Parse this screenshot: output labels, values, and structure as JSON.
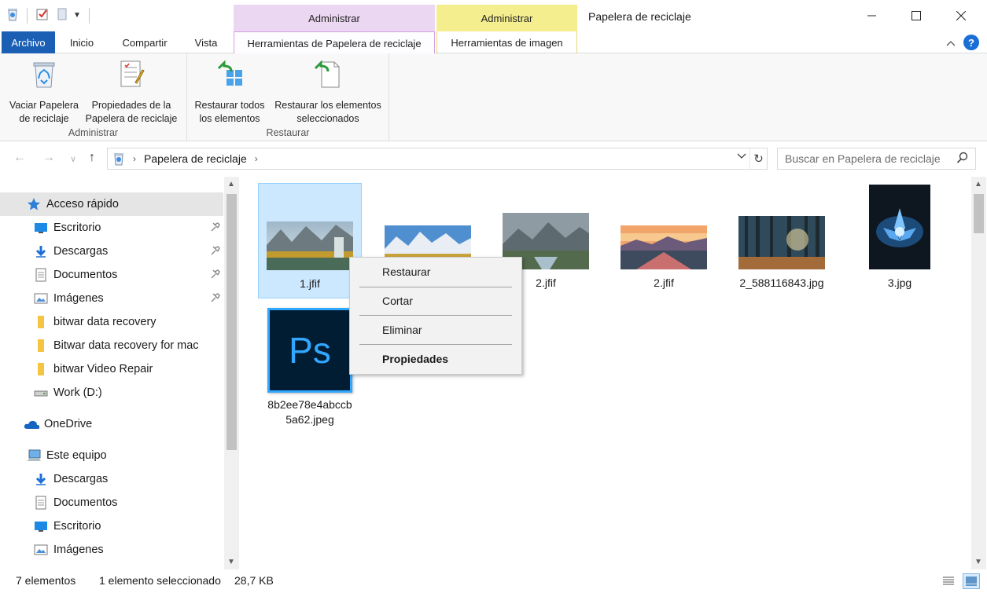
{
  "window": {
    "title": "Papelera de reciclaje",
    "context_tab_admin_1": "Administrar",
    "context_tab_admin_2": "Administrar"
  },
  "ribbon_tabs": {
    "file": "Archivo",
    "inicio": "Inicio",
    "compartir": "Compartir",
    "vista": "Vista",
    "recycle_tools": "Herramientas de Papelera de reciclaje",
    "image_tools": "Herramientas de imagen"
  },
  "ribbon": {
    "groups": {
      "admin_label": "Administrar",
      "restore_label": "Restaurar"
    },
    "buttons": {
      "empty_line1": "Vaciar Papelera",
      "empty_line2": "de reciclaje",
      "props_line1": "Propiedades de la",
      "props_line2": "Papelera de reciclaje",
      "restore_all_line1": "Restaurar todos",
      "restore_all_line2": "los elementos",
      "restore_sel_line1": "Restaurar los elementos",
      "restore_sel_line2": "seleccionados"
    }
  },
  "address": {
    "crumb": "Papelera de reciclaje",
    "search_placeholder": "Buscar en Papelera de reciclaje"
  },
  "sidebar": {
    "items": [
      {
        "label": "Acceso rápido",
        "icon": "star-icon"
      },
      {
        "label": "Escritorio",
        "icon": "desktop-icon"
      },
      {
        "label": "Descargas",
        "icon": "download-icon"
      },
      {
        "label": "Documentos",
        "icon": "document-icon"
      },
      {
        "label": "Imágenes",
        "icon": "pictures-icon"
      },
      {
        "label": "bitwar data recovery",
        "icon": "folder-icon"
      },
      {
        "label": "Bitwar data recovery for mac",
        "icon": "folder-icon"
      },
      {
        "label": "bitwar Video Repair",
        "icon": "folder-icon"
      },
      {
        "label": "Work (D:)",
        "icon": "drive-icon"
      },
      {
        "label": "OneDrive",
        "icon": "cloud-icon"
      },
      {
        "label": "Este equipo",
        "icon": "computer-icon"
      },
      {
        "label": "Descargas",
        "icon": "download-icon"
      },
      {
        "label": "Documentos",
        "icon": "document-icon"
      },
      {
        "label": "Escritorio",
        "icon": "desktop-icon"
      },
      {
        "label": "Imágenes",
        "icon": "pictures-icon"
      }
    ]
  },
  "files": [
    {
      "name": "1.jfif"
    },
    {
      "name": "2.jfif"
    },
    {
      "name": "2.jfif"
    },
    {
      "name": "2_588116843.jpg"
    },
    {
      "name": "3.jpg"
    },
    {
      "name_line1": "8b2ee78e4abccb",
      "name_line2": "5a62.jpeg",
      "ps_text": "Ps"
    }
  ],
  "context_menu": {
    "restore": "Restaurar",
    "cut": "Cortar",
    "delete": "Eliminar",
    "properties": "Propiedades"
  },
  "status": {
    "count": "7 elementos",
    "selection": "1 elemento seleccionado",
    "size": "28,7 KB"
  },
  "colors": {
    "accent": "#1a5fb4",
    "selection": "#cce8ff",
    "purple_context": "#ecd7f3",
    "yellow_context": "#f4ee8f"
  }
}
